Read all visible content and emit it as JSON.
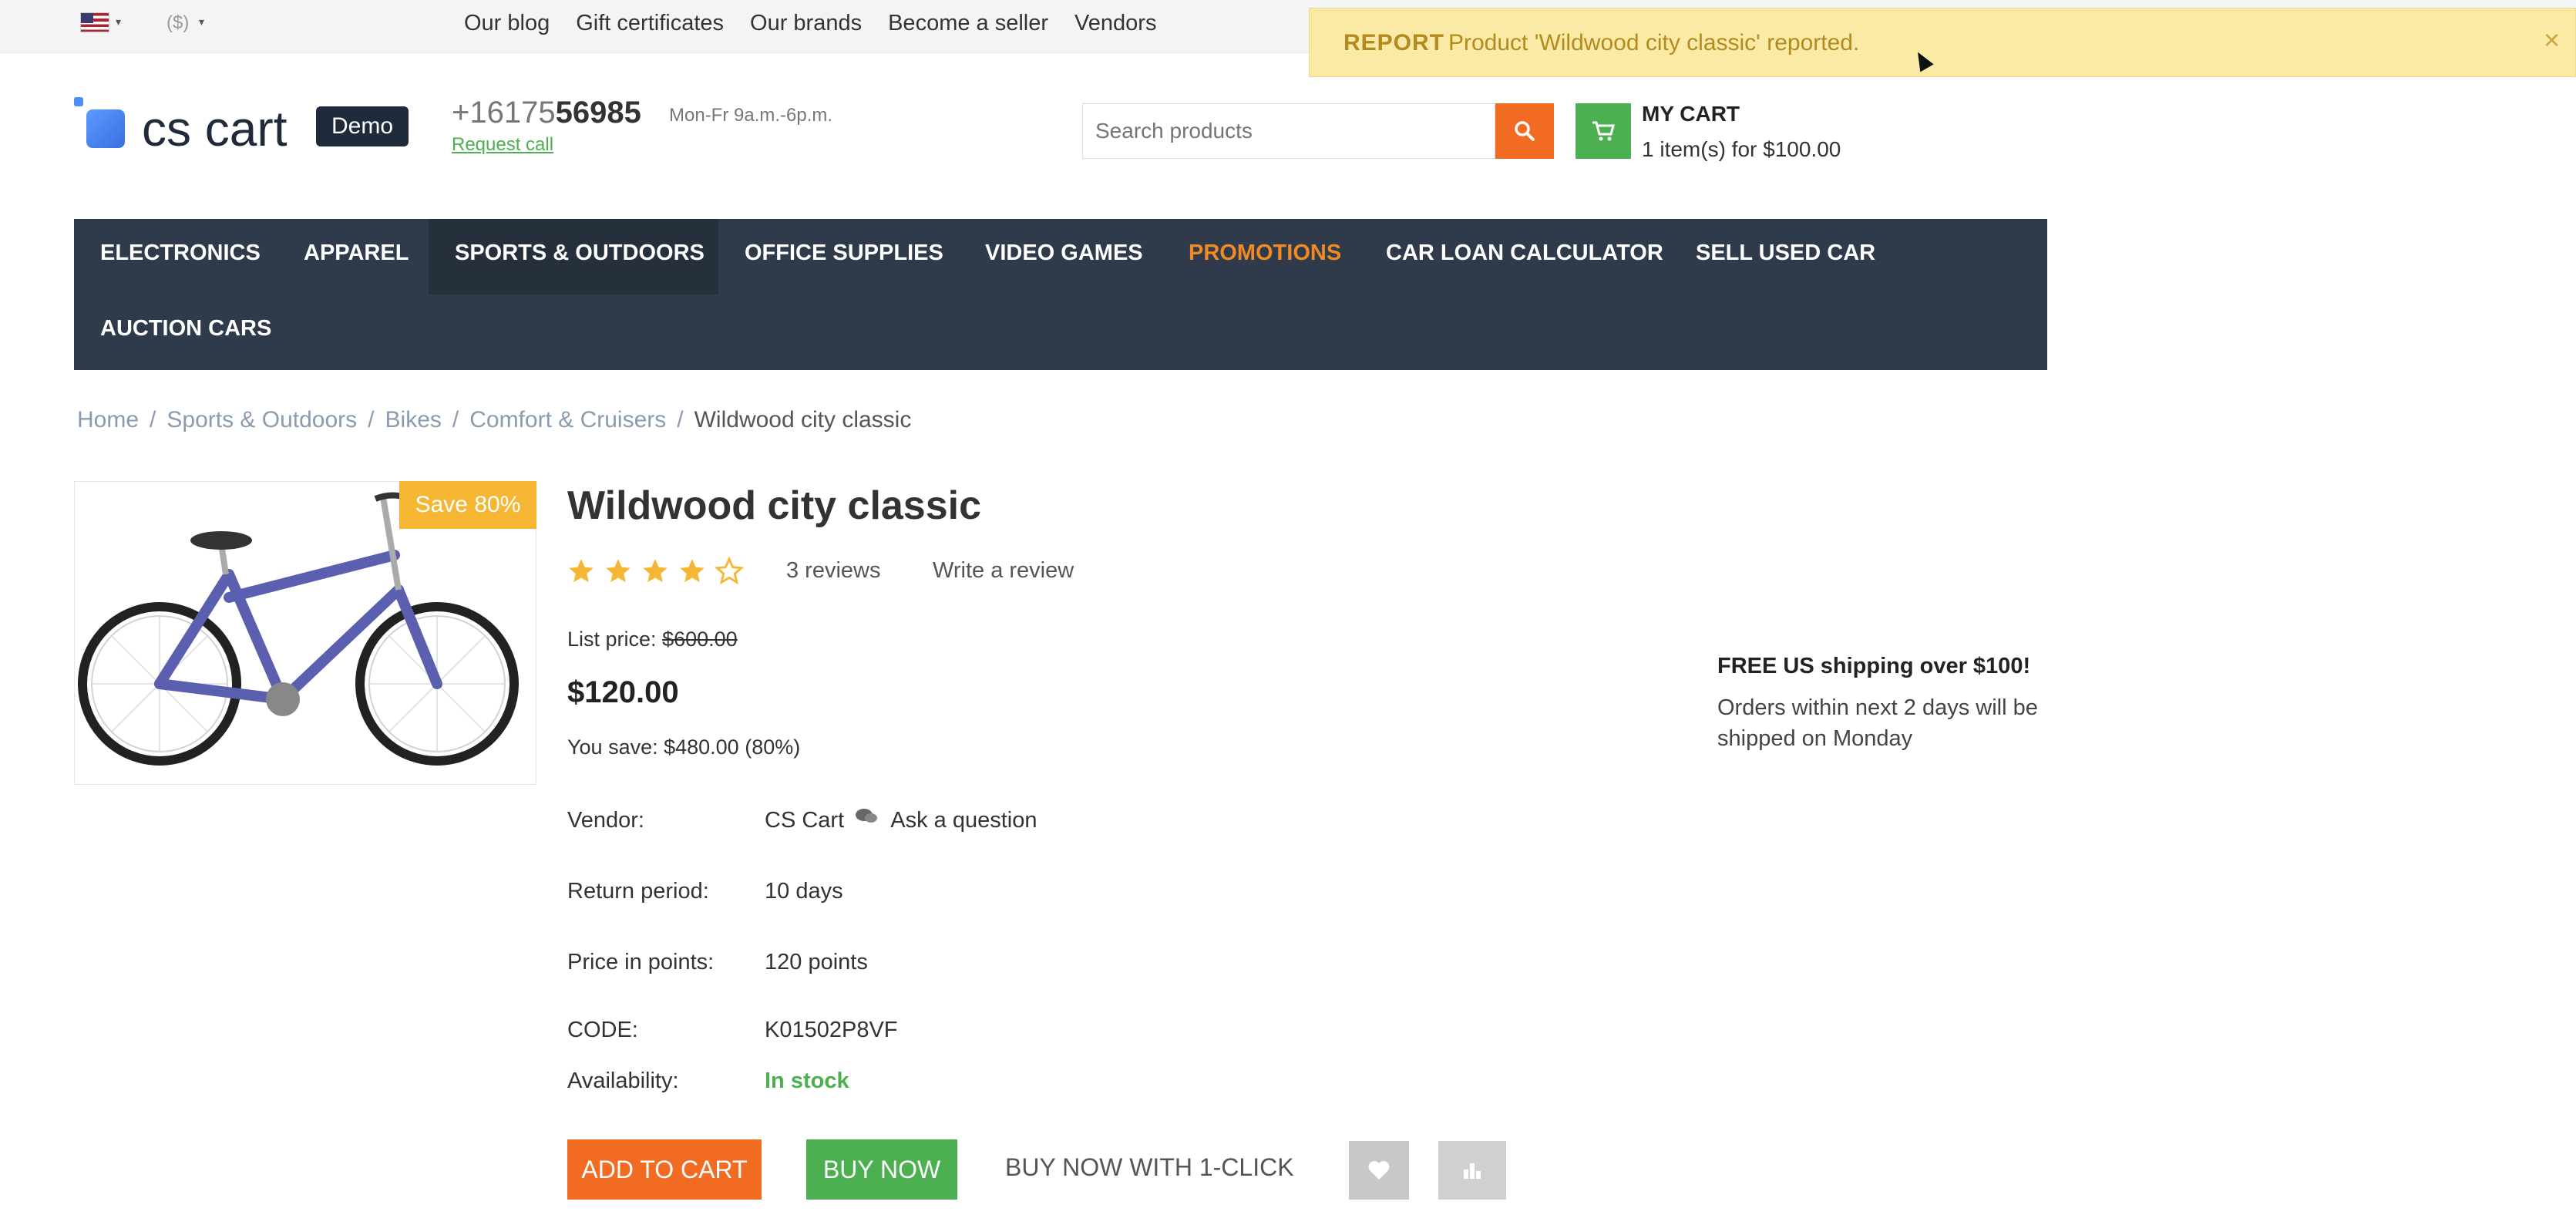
{
  "topbar": {
    "currency": "($)",
    "links": [
      "Our blog",
      "Gift certificates",
      "Our brands",
      "Become a seller",
      "Vendors"
    ]
  },
  "notification": {
    "title": "REPORT",
    "text": "Product 'Wildwood city classic' reported.",
    "close": "×"
  },
  "header": {
    "logo_text": "cs cart",
    "badge": "Demo",
    "phone_prefix": "+16175",
    "phone_bold": "56985",
    "hours": "Mon-Fr 9a.m.-6p.m.",
    "request_call": "Request call",
    "search_placeholder": "Search products",
    "cart_title": "MY CART",
    "cart_info": "1 item(s) for $100.00"
  },
  "nav": {
    "items": [
      "ELECTRONICS",
      "APPAREL",
      "SPORTS & OUTDOORS",
      "OFFICE SUPPLIES",
      "VIDEO GAMES",
      "PROMOTIONS",
      "CAR LOAN CALCULATOR",
      "SELL USED CAR",
      "AUCTION CARS"
    ]
  },
  "breadcrumbs": [
    "Home",
    "Sports & Outdoors",
    "Bikes",
    "Comfort & Cruisers",
    "Wildwood city classic"
  ],
  "product": {
    "save_badge": "Save 80%",
    "title": "Wildwood city classic",
    "rating": 4,
    "rating_max": 5,
    "reviews": "3 reviews",
    "write_review": "Write a review",
    "list_price_label": "List price:",
    "list_price": "$600.00",
    "price": "$120.00",
    "you_save": "You save: $480.00 (80%)",
    "vendor_label": "Vendor:",
    "vendor": "CS Cart",
    "ask_question": "Ask a question",
    "return_label": "Return period:",
    "return_value": "10 days",
    "points_label": "Price in points:",
    "points_value": "120 points",
    "code_label": "CODE:",
    "code_value": "K01502P8VF",
    "availability_label": "Availability:",
    "availability_value": "In stock"
  },
  "shipping": {
    "title": "FREE US shipping over $100!",
    "text": "Orders within next 2 days will be shipped on Monday"
  },
  "buttons": {
    "add_to_cart": "ADD TO CART",
    "buy_now": "BUY NOW",
    "one_click": "BUY NOW WITH 1-CLICK"
  },
  "colors": {
    "accent_orange": "#f26b22",
    "accent_green": "#4caf50",
    "nav_bg": "#2f3a4a",
    "badge_yellow": "#f5b733"
  }
}
